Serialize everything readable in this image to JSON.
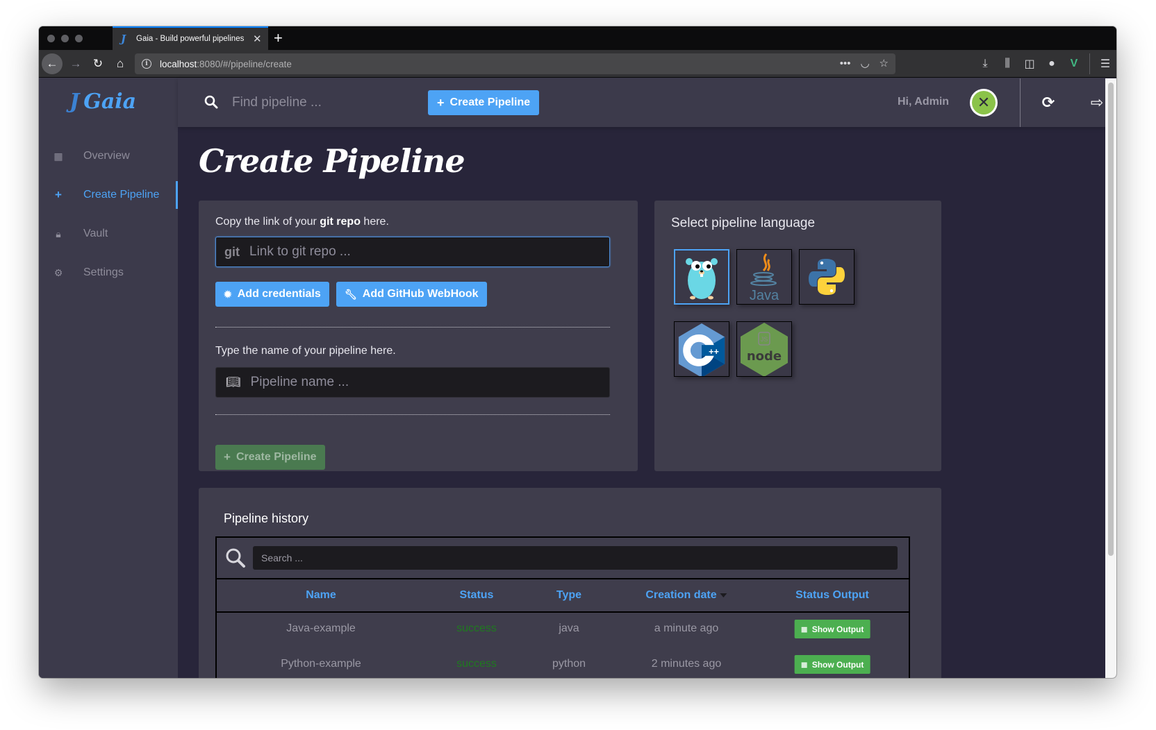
{
  "browser": {
    "tab_title": "Gaia - Build powerful pipelines",
    "url_host": "localhost",
    "url_path": ":8080/#/pipeline/create",
    "icons": [
      "back-icon",
      "forward-icon",
      "reload-icon",
      "home-icon",
      "info-icon",
      "more-icon",
      "pocket-icon",
      "bookmark-star-icon",
      "download-icon",
      "library-icon",
      "sidebar-icon",
      "extension-icon",
      "vue-devtools-icon",
      "menu-icon"
    ]
  },
  "sidebar": {
    "logo_text": "Gaia",
    "items": [
      {
        "label": "Overview",
        "icon": "grid-icon",
        "active": false
      },
      {
        "label": "Create Pipeline",
        "icon": "plus-icon",
        "active": true
      },
      {
        "label": "Vault",
        "icon": "lock-icon",
        "active": false
      },
      {
        "label": "Settings",
        "icon": "gears-icon",
        "active": false
      }
    ]
  },
  "topbar": {
    "search_placeholder": "Find pipeline ...",
    "create_button": "Create Pipeline",
    "greeting": "Hi, Admin"
  },
  "main": {
    "page_title": "Create Pipeline",
    "git_card": {
      "label_prefix": "Copy the link of your ",
      "label_bold": "git repo",
      "label_suffix": " here.",
      "git_prefix": "git",
      "git_placeholder": "Link to git repo ...",
      "add_credentials": "Add credentials",
      "add_webhook": "Add GitHub WebHook",
      "name_label": "Type the name of your pipeline here.",
      "name_placeholder": "Pipeline name ...",
      "create_button": "Create Pipeline"
    },
    "language_card": {
      "title": "Select pipeline language",
      "languages": [
        {
          "name": "Go",
          "selected": true
        },
        {
          "name": "Java",
          "selected": false
        },
        {
          "name": "Python",
          "selected": false
        },
        {
          "name": "C++",
          "selected": false
        },
        {
          "name": "Node.js",
          "selected": false
        }
      ]
    },
    "history": {
      "title": "Pipeline history",
      "search_placeholder": "Search ...",
      "columns": [
        "Name",
        "Status",
        "Type",
        "Creation date",
        "Status Output"
      ],
      "sorted_column": "Creation date",
      "rows": [
        {
          "name": "Java-example",
          "status": "success",
          "type": "java",
          "created": "a minute ago",
          "action": "Show Output"
        },
        {
          "name": "Python-example",
          "status": "success",
          "type": "python",
          "created": "2 minutes ago",
          "action": "Show Output"
        }
      ]
    }
  },
  "colors": {
    "accent": "#4da3f5",
    "success_text": "#1f7a1f",
    "success_button": "#4caf50",
    "sidebar_bg": "#3c3a4b",
    "content_bg": "#28253a"
  }
}
